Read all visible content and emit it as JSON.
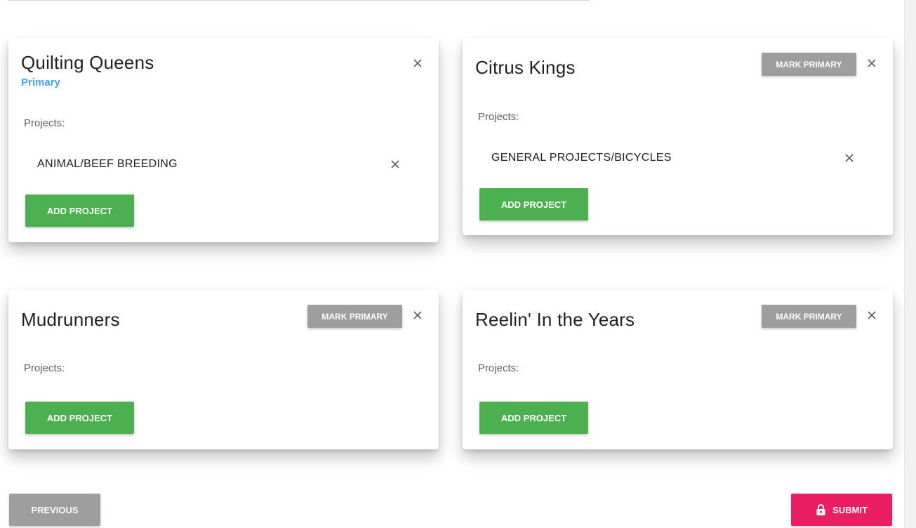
{
  "colors": {
    "add_button": "#4caf50",
    "mark_primary_button": "#9e9e9e",
    "primary_label": "#42a5f5",
    "submit_button": "#e91e63",
    "previous_button": "#9e9e9e"
  },
  "cards": [
    {
      "title": "Quilting Queens",
      "primary_label": "Primary",
      "projects_label": "Projects:",
      "projects": [
        "ANIMAL/BEEF BREEDING"
      ],
      "add_project_label": "ADD PROJECT"
    },
    {
      "title": "Citrus Kings",
      "mark_primary_label": "MARK PRIMARY",
      "projects_label": "Projects:",
      "projects": [
        "GENERAL PROJECTS/BICYCLES"
      ],
      "add_project_label": "ADD PROJECT"
    },
    {
      "title": "Mudrunners",
      "mark_primary_label": "MARK PRIMARY",
      "projects_label": "Projects:",
      "projects": [],
      "add_project_label": "ADD PROJECT"
    },
    {
      "title": "Reelin' In the Years",
      "mark_primary_label": "MARK PRIMARY",
      "projects_label": "Projects:",
      "projects": [],
      "add_project_label": "ADD PROJECT"
    }
  ],
  "footer": {
    "previous_label": "PREVIOUS",
    "submit_label": "SUBMIT",
    "submit_icon": "lock-icon"
  },
  "icons": {
    "remove_club": "close-icon",
    "remove_project": "close-icon"
  }
}
